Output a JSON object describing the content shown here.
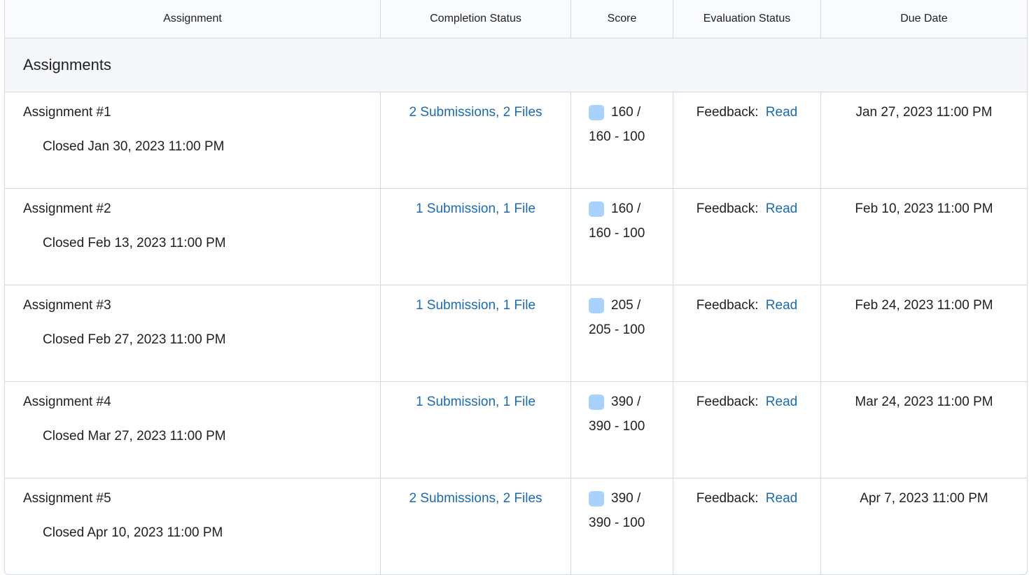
{
  "columns": {
    "assignment": "Assignment",
    "completion_status": "Completion Status",
    "score": "Score",
    "evaluation_status": "Evaluation Status",
    "due_date": "Due Date"
  },
  "section_title": "Assignments",
  "rows": [
    {
      "name": "Assignment #1",
      "closed": "Closed Jan 30, 2023 11:00 PM",
      "completion": "2 Submissions, 2 Files",
      "score_top": "160 /",
      "score_bottom": "160 - 100",
      "feedback_label": "Feedback:",
      "feedback_link": "Read",
      "due": "Jan 27, 2023 11:00 PM"
    },
    {
      "name": "Assignment #2",
      "closed": "Closed Feb 13, 2023 11:00 PM",
      "completion": "1 Submission, 1 File",
      "score_top": "160 /",
      "score_bottom": "160 - 100",
      "feedback_label": "Feedback:",
      "feedback_link": "Read",
      "due": "Feb 10, 2023 11:00 PM"
    },
    {
      "name": "Assignment #3",
      "closed": "Closed Feb 27, 2023 11:00 PM",
      "completion": "1 Submission, 1 File",
      "score_top": "205 /",
      "score_bottom": "205 - 100",
      "feedback_label": "Feedback:",
      "feedback_link": "Read",
      "due": "Feb 24, 2023 11:00 PM"
    },
    {
      "name": "Assignment #4",
      "closed": "Closed Mar 27, 2023 11:00 PM",
      "completion": "1 Submission, 1 File",
      "score_top": "390 /",
      "score_bottom": "390 - 100",
      "feedback_label": "Feedback:",
      "feedback_link": "Read",
      "due": "Mar 24, 2023 11:00 PM"
    },
    {
      "name": "Assignment #5",
      "closed": "Closed Apr 10, 2023 11:00 PM",
      "completion": "2 Submissions, 2 Files",
      "score_top": "390 /",
      "score_bottom": "390 - 100",
      "feedback_label": "Feedback:",
      "feedback_link": "Read",
      "due": "Apr 7, 2023 11:00 PM"
    }
  ],
  "colors": {
    "link": "#1c6bb0",
    "score_indicator": "#a8d1fb",
    "header_bg": "#f9fbff",
    "section_bg": "#f5f7fb",
    "border": "#d3d9e3"
  },
  "icons": {
    "score_indicator": "score-indicator-icon"
  }
}
